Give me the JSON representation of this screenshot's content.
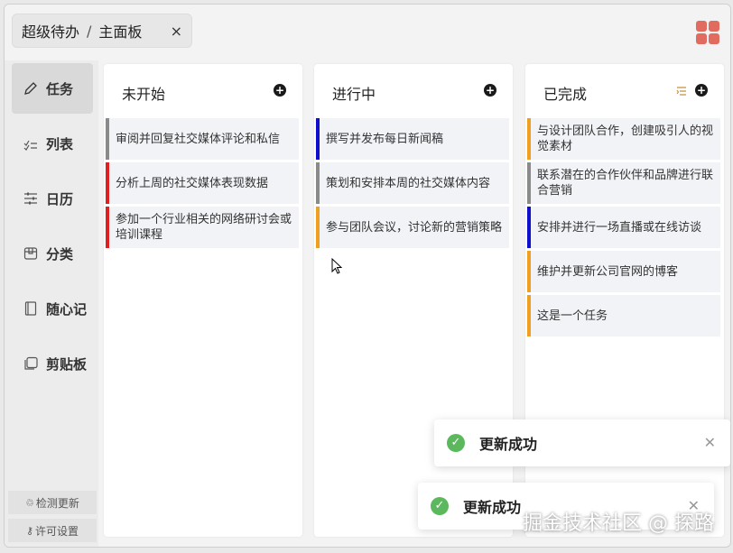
{
  "tab": {
    "app_name": "超级待办",
    "separator": "/",
    "page_name": "主面板",
    "close": "×"
  },
  "brand": {
    "icon": "grid-icon",
    "color": "#e06b5e"
  },
  "sidebar": {
    "items": [
      {
        "label": "任务",
        "icon": "pencil-icon",
        "active": true
      },
      {
        "label": "列表",
        "icon": "checklist-icon"
      },
      {
        "label": "日历",
        "icon": "sliders-icon"
      },
      {
        "label": "分类",
        "icon": "box-icon"
      },
      {
        "label": "随心记",
        "icon": "notebook-icon"
      },
      {
        "label": "剪贴板",
        "icon": "clipboard-icon"
      }
    ],
    "check_update": "检测更新",
    "license": "许可设置"
  },
  "columns": [
    {
      "title": "未开始",
      "cards": [
        {
          "text": "审阅并回复社交媒体评论和私信",
          "color": "#8a8a8a"
        },
        {
          "text": "分析上周的社交媒体表现数据",
          "color": "#e02020"
        },
        {
          "text": "参加一个行业相关的网络研讨会或培训课程",
          "color": "#e02020"
        }
      ]
    },
    {
      "title": "进行中",
      "cards": [
        {
          "text": "撰写并发布每日新闻稿",
          "color": "#1010cc"
        },
        {
          "text": "策划和安排本周的社交媒体内容",
          "color": "#8a8a8a"
        },
        {
          "text": "参与团队会议，讨论新的营销策略",
          "color": "#f0a020"
        }
      ]
    },
    {
      "title": "已完成",
      "cards": [
        {
          "text": "与设计团队合作，创建吸引人的视觉素材",
          "color": "#f0a020"
        },
        {
          "text": "联系潜在的合作伙伴和品牌进行联合营销",
          "color": "#8a8a8a"
        },
        {
          "text": "安排并进行一场直播或在线访谈",
          "color": "#1010cc"
        },
        {
          "text": "维护并更新公司官网的博客",
          "color": "#f0a020"
        },
        {
          "text": "这是一个任务",
          "color": "#f0a020"
        }
      ]
    }
  ],
  "toasts": [
    {
      "message": "更新成功"
    },
    {
      "message": "更新成功"
    }
  ],
  "watermark": "掘金技术社区 @ 探路"
}
